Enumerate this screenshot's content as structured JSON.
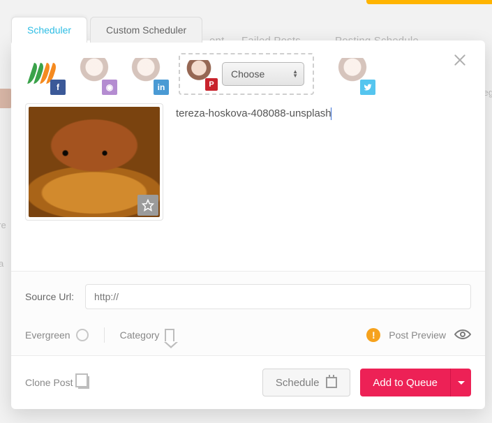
{
  "tabs": {
    "scheduler": "Scheduler",
    "custom_scheduler": "Custom Scheduler"
  },
  "background_nav": {
    "item_failed": "Failed Posts",
    "item_schedule": "Posting Schedule",
    "right_label": "eg",
    "side_label1": "ere",
    "side_label2": "a",
    "partial_ent": "ent"
  },
  "profiles": {
    "logo_name": "brand-logo",
    "fb_badge": "f",
    "ig_badge": "◉",
    "li_badge": "in",
    "pi_badge": "P",
    "tw_badge": "t",
    "choose_label": "Choose"
  },
  "compose": {
    "caption_text": "tereza-hoskova-408088-unsplash"
  },
  "meta": {
    "source_url_label": "Source Url:",
    "source_url_placeholder": "http://",
    "evergreen_label": "Evergreen",
    "category_label": "Category",
    "preview_label": "Post Preview",
    "warn_text": "!"
  },
  "footer": {
    "clone_label": "Clone Post",
    "schedule_label": "Schedule",
    "queue_label": "Add to Queue"
  }
}
